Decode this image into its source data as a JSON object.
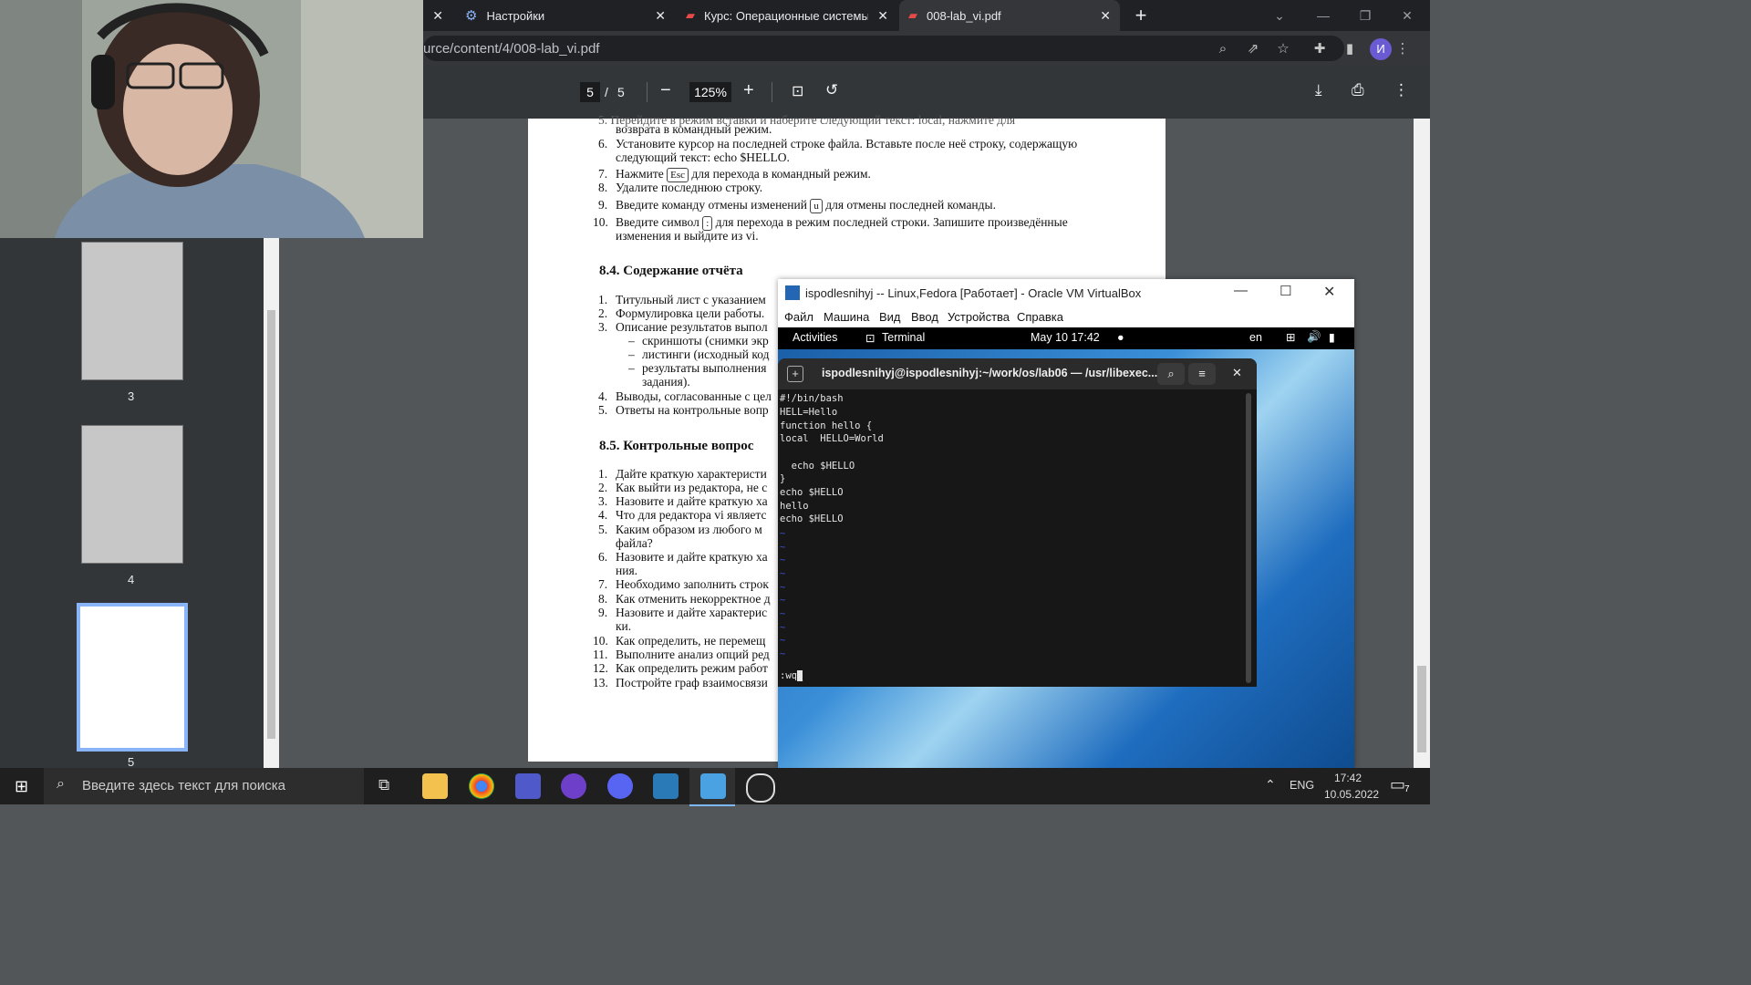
{
  "browser": {
    "tabs": [
      {
        "title": "",
        "close": "✕"
      },
      {
        "title": "Настройки",
        "close": "✕"
      },
      {
        "title": "Курс: Операционные системы (",
        "close": "✕"
      },
      {
        "title": "008-lab_vi.pdf",
        "close": "✕",
        "active": true
      }
    ],
    "new_tab": "+",
    "url": "urce/content/4/008-lab_vi.pdf",
    "profile_initial": "И"
  },
  "pdf": {
    "page_current": "5",
    "page_sep": "/",
    "page_total": "5",
    "zoom": "125%",
    "thumbnails": [
      {
        "label": "3"
      },
      {
        "label": "4"
      },
      {
        "label": "5"
      }
    ],
    "content": {
      "cut_line": "5.  Перейдите в режим вставки и наберите следующий текст: local, нажмите      для",
      "cut_line2": "возврата в командный режим.",
      "items_top": [
        {
          "num": "6.",
          "text": "Установите курсор на последней строке файла. Вставьте после неё строку, содержащую"
        },
        {
          "num": "",
          "text": "следующий текст: echo  $HELLO."
        },
        {
          "num": "7.",
          "text_pre": "Нажмите",
          "key": "Esc",
          "text_post": "для перехода в командный режим."
        },
        {
          "num": "8.",
          "text": "Удалите последнюю строку."
        },
        {
          "num": "9.",
          "text_pre": "Введите команду отмены изменений",
          "key": "u",
          "text_post": "для отмены последней команды."
        },
        {
          "num": "10.",
          "text_pre": "Введите символ",
          "key": ":",
          "text_post": "для перехода в режим последней строки. Запишите произведённые"
        },
        {
          "num": "",
          "text": "изменения и выйдите из vi."
        }
      ],
      "section_84": "8.4.    Содержание отчёта",
      "items_84": [
        {
          "num": "1.",
          "text": "Титульный лист с указанием"
        },
        {
          "num": "2.",
          "text": "Формулировка цели работы."
        },
        {
          "num": "3.",
          "text": "Описание результатов выпол"
        },
        {
          "num": "–",
          "text": "скриншоты (снимки экр"
        },
        {
          "num": "–",
          "text": "листинги (исходный код"
        },
        {
          "num": "–",
          "text": "результаты выполнения"
        },
        {
          "num": "",
          "text": "задания)."
        },
        {
          "num": "4.",
          "text": "Выводы, согласованные с цел"
        },
        {
          "num": "5.",
          "text": "Ответы на контрольные вопр"
        }
      ],
      "section_85": "8.5.    Контрольные вопрос",
      "items_85": [
        {
          "num": "1.",
          "text": "Дайте краткую характеристи"
        },
        {
          "num": "2.",
          "text": "Как выйти из редактора, не с"
        },
        {
          "num": "3.",
          "text": "Назовите и дайте краткую ха"
        },
        {
          "num": "4.",
          "text": "Что для редактора vi являетс"
        },
        {
          "num": "5.",
          "text": "Каким образом из любого м"
        },
        {
          "num": "",
          "text": "файла?"
        },
        {
          "num": "6.",
          "text": "Назовите и дайте краткую ха"
        },
        {
          "num": "",
          "text": "ния."
        },
        {
          "num": "7.",
          "text": "Необходимо заполнить строк"
        },
        {
          "num": "8.",
          "text": "Как отменить некорректное д"
        },
        {
          "num": "9.",
          "text": "Назовите и дайте характерис"
        },
        {
          "num": "",
          "text": "ки."
        },
        {
          "num": "10.",
          "text": "Как определить, не перемещ"
        },
        {
          "num": "11.",
          "text": "Выполните анализ опций ред"
        },
        {
          "num": "12.",
          "text": "Как определить режим работ"
        },
        {
          "num": "13.",
          "text": "Постройте граф взаимосвязи"
        }
      ]
    }
  },
  "vbox": {
    "title": "ispodlesnihyj -- Linux,Fedora [Работает] - Oracle VM VirtualBox",
    "menu": [
      "Файл",
      "Машина",
      "Вид",
      "Ввод",
      "Устройства",
      "Справка"
    ],
    "gnome": {
      "activities": "Activities",
      "app": "Terminal",
      "clock": "May 10  17:42",
      "lang": "en"
    },
    "terminal": {
      "title": "ispodlesnihyj@ispodlesnihyj:~/work/os/lab06 — /usr/libexec...",
      "lines": [
        "#!/bin/bash",
        "HELL=Hello",
        "function hello {",
        "local  HELLO=World",
        "",
        "  echo $HELLO",
        "}",
        "echo $HELLO",
        "hello",
        "echo $HELLO"
      ],
      "tilde": "~",
      "command": ":wq"
    }
  },
  "taskbar": {
    "search_placeholder": "Введите здесь текст для поиска",
    "lang": "ENG",
    "time": "17:42",
    "date": "10.05.2022",
    "notif_count": "7"
  }
}
